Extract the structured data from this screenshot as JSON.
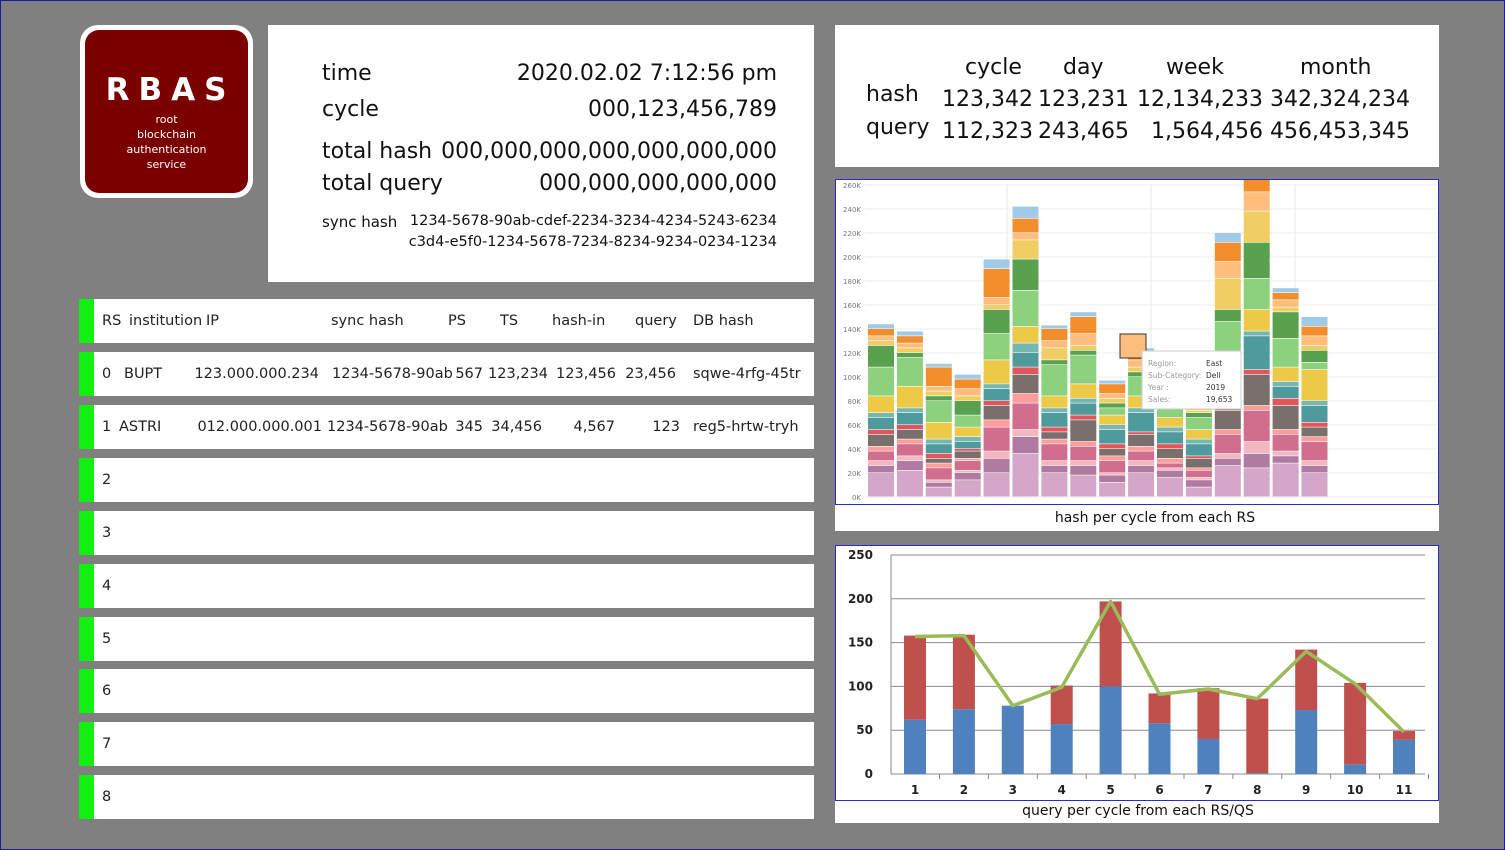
{
  "logo": {
    "title": "RBAS",
    "line1": "root",
    "line2": "blockchain",
    "line3": "authentication",
    "line4": "service"
  },
  "info": {
    "time_label": "time",
    "time_value": "2020.02.02  7:12:56  pm",
    "cycle_label": "cycle",
    "cycle_value": "000,123,456,789",
    "total_hash_label": "total hash",
    "total_hash_value": "000,000,000,000,000,000,000",
    "total_query_label": "total query",
    "total_query_value": "000,000,000,000,000",
    "sync_hash_label": "sync hash",
    "sync_hash_line1": "1234-5678-90ab-cdef-2234-3234-4234-5243-6234",
    "sync_hash_line2": "c3d4-e5f0-1234-5678-7234-8234-9234-0234-1234"
  },
  "summary": {
    "headers": [
      "cycle",
      "day",
      "week",
      "month"
    ],
    "hash_label": "hash",
    "hash_values": [
      "123,342",
      "123,231",
      "12,134,233",
      "342,324,234"
    ],
    "query_label": "query",
    "query_values": [
      "112,323",
      "243,465",
      "1,564,456",
      "456,453,345"
    ]
  },
  "table": {
    "headers": {
      "rs": "RS",
      "institution": "institution",
      "ip": "IP",
      "sync_hash": "sync hash",
      "ps": "PS",
      "ts": "TS",
      "hash_in": "hash-in",
      "query": "query",
      "db_hash": "DB hash"
    },
    "rows": [
      {
        "rs": "0",
        "institution": "BUPT",
        "ip": "123.000.000.234",
        "sync_hash": "1234-5678-90ab",
        "ps": "567",
        "ts": "123,234",
        "hash_in": "123,456",
        "query": "23,456",
        "db_hash": "sqwe-4rfg-45tr"
      },
      {
        "rs": "1",
        "institution": "ASTRI",
        "ip": "012.000.000.001",
        "sync_hash": "1234-5678-90ab",
        "ps": "345",
        "ts": "34,456",
        "hash_in": "4,567",
        "query": "123",
        "db_hash": "reg5-hrtw-tryh"
      },
      {
        "rs": "2"
      },
      {
        "rs": "3"
      },
      {
        "rs": "4"
      },
      {
        "rs": "5"
      },
      {
        "rs": "6"
      },
      {
        "rs": "7"
      },
      {
        "rs": "8"
      }
    ]
  },
  "hash_chart": {
    "caption": "hash per cycle from each RS",
    "y_ticks": [
      "0K",
      "20K",
      "40K",
      "60K",
      "80K",
      "100K",
      "120K",
      "140K",
      "160K",
      "180K",
      "200K",
      "220K",
      "240K",
      "260K"
    ],
    "colors": [
      "#d4a6c8",
      "#b07aa1",
      "#f4b6c1",
      "#d16e8d",
      "#ff9d9a",
      "#79706e",
      "#e15759",
      "#4e9a9c",
      "#76b7b2",
      "#edc948",
      "#8cd17d",
      "#59a14f",
      "#f1ce63",
      "#ffbe7d",
      "#f28e2b",
      "#a0cbe8"
    ],
    "bars": [
      [
        20,
        6,
        4,
        8,
        4,
        10,
        4,
        10,
        4,
        14,
        24,
        18,
        4,
        4,
        6,
        4
      ],
      [
        22,
        8,
        4,
        10,
        4,
        8,
        4,
        10,
        4,
        18,
        24,
        4,
        4,
        4,
        6,
        4
      ],
      [
        8,
        4,
        2,
        10,
        4,
        4,
        4,
        8,
        4,
        14,
        18,
        4,
        4,
        4,
        16,
        3
      ],
      [
        14,
        6,
        2,
        8,
        2,
        6,
        2,
        6,
        4,
        8,
        10,
        12,
        4,
        6,
        8,
        4
      ],
      [
        20,
        12,
        6,
        20,
        6,
        12,
        4,
        10,
        4,
        20,
        22,
        20,
        4,
        6,
        24,
        8
      ],
      [
        36,
        14,
        6,
        22,
        8,
        16,
        6,
        12,
        8,
        14,
        30,
        26,
        16,
        6,
        12,
        10
      ],
      [
        20,
        6,
        4,
        14,
        4,
        6,
        4,
        12,
        4,
        10,
        26,
        4,
        10,
        6,
        10,
        3
      ],
      [
        18,
        8,
        4,
        12,
        4,
        18,
        4,
        10,
        4,
        12,
        24,
        4,
        4,
        10,
        14,
        4
      ],
      [
        12,
        6,
        2,
        10,
        4,
        6,
        4,
        12,
        4,
        8,
        6,
        4,
        4,
        4,
        8,
        3
      ],
      [
        20,
        6,
        4,
        8,
        4,
        10,
        2,
        16,
        4,
        10,
        16,
        4,
        4,
        6,
        6,
        4
      ],
      [
        16,
        6,
        2,
        4,
        4,
        8,
        4,
        10,
        4,
        8,
        14,
        4,
        4,
        4,
        8,
        3
      ],
      [
        8,
        6,
        2,
        6,
        2,
        8,
        2,
        10,
        4,
        8,
        10,
        4,
        2,
        2,
        4,
        3
      ],
      [
        26,
        6,
        4,
        16,
        4,
        16,
        4,
        24,
        4,
        12,
        30,
        10,
        26,
        14,
        16,
        8
      ],
      [
        24,
        12,
        10,
        26,
        4,
        26,
        4,
        28,
        4,
        18,
        26,
        30,
        26,
        16,
        16,
        10
      ],
      [
        28,
        6,
        4,
        14,
        4,
        20,
        6,
        10,
        4,
        12,
        24,
        22,
        4,
        6,
        6,
        4
      ],
      [
        20,
        6,
        4,
        16,
        4,
        8,
        4,
        14,
        4,
        26,
        6,
        10,
        4,
        8,
        8,
        8
      ]
    ],
    "tooltip": {
      "region_label": "Region:",
      "region_value": "East",
      "subcat_label": "Sub-Category:",
      "subcat_value": "Dell",
      "year_label": "Year :",
      "year_value": "2019",
      "sales_label": "Sales:",
      "sales_value": "19,653"
    }
  },
  "chart_data": {
    "type": "bar",
    "caption": "query per cycle from each RS/QS",
    "categories": [
      "1",
      "2",
      "3",
      "4",
      "5",
      "6",
      "7",
      "8",
      "9",
      "10",
      "11"
    ],
    "y_ticks": [
      "0",
      "50",
      "100",
      "150",
      "200",
      "250"
    ],
    "ylim": [
      0,
      250
    ],
    "series": [
      {
        "values": [
          62,
          74,
          78,
          57,
          100,
          58,
          40,
          1,
          73,
          11,
          39
        ],
        "color": "#4f81bd"
      },
      {
        "values": [
          96,
          85,
          0,
          44,
          97,
          34,
          58,
          85,
          69,
          93,
          10
        ],
        "color": "#c0504d"
      },
      {
        "values": [
          157,
          158,
          78,
          99,
          197,
          91,
          97,
          86,
          140,
          103,
          48
        ],
        "color": "#9bbb59",
        "kind": "line"
      }
    ]
  }
}
